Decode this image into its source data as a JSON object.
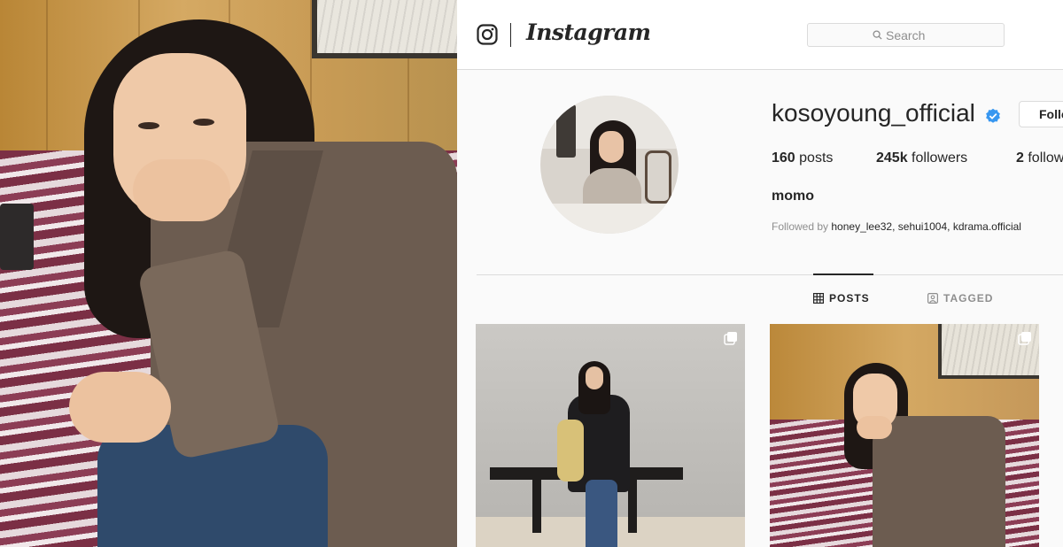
{
  "app": {
    "wordmark": "Instagram"
  },
  "search": {
    "placeholder": "Search"
  },
  "profile": {
    "username": "kosoyoung_official",
    "follow_label": "Follow",
    "stats": [
      {
        "value": "160",
        "label": "posts"
      },
      {
        "value": "245k",
        "label": "followers"
      },
      {
        "value": "2",
        "label": "following"
      }
    ],
    "display_name": "momo",
    "followed_by_prefix": "Followed by",
    "followed_by_names": "honey_lee32, sehui1004, kdrama.official"
  },
  "tabs": [
    {
      "label": "POSTS",
      "icon": "grid-icon",
      "active": true
    },
    {
      "label": "TAGGED",
      "icon": "tag-icon",
      "active": false
    }
  ],
  "icons": {
    "logo": "instagram-camera-icon",
    "search": "search-icon",
    "verified": "verified-badge-icon",
    "post_multi": "carousel-multi-icon"
  },
  "colors": {
    "verified": "#3897f0",
    "text": "#262626",
    "muted": "#8e8e8e",
    "border": "#dbdbdb",
    "background": "#fafafa"
  }
}
